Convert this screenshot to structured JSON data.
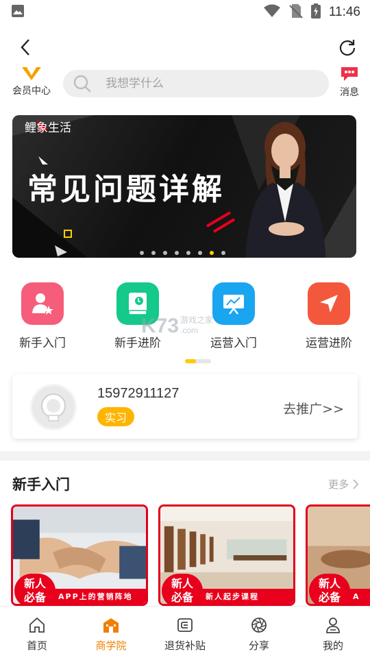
{
  "status_bar": {
    "time": "11:46"
  },
  "top_bar": {
    "member_center": "会员中心",
    "messages": "消息",
    "search_placeholder": "我想学什么"
  },
  "banner": {
    "brand": "鲤象生活",
    "headline": "常见问题详解",
    "dot_count": 8,
    "active_dot": 7
  },
  "categories": [
    {
      "label": "新手入门",
      "icon": "person-star-icon",
      "color": "#f55d7a"
    },
    {
      "label": "新手进阶",
      "icon": "book-icon",
      "color": "#14c98a"
    },
    {
      "label": "运营入门",
      "icon": "presentation-icon",
      "color": "#1aa5f0"
    },
    {
      "label": "运营进阶",
      "icon": "navigation-arrow-icon",
      "color": "#f4583c"
    }
  ],
  "watermark": {
    "site": "K73",
    "text": "游戏之家",
    "domain": ".com"
  },
  "user": {
    "phone": "15972911127",
    "level": "实习",
    "promote": "去推广>>"
  },
  "section": {
    "title": "新手入门",
    "more": "更多"
  },
  "courses": [
    {
      "tag": "新人必备",
      "ribbon": "APP上的营销阵地"
    },
    {
      "tag": "新人必备",
      "ribbon": "新人起步课程"
    },
    {
      "tag": "新人必备",
      "ribbon": "A"
    }
  ],
  "bottom_nav": [
    {
      "label": "首页",
      "icon": "home-icon"
    },
    {
      "label": "商学院",
      "icon": "school-icon",
      "active": true
    },
    {
      "label": "退货补贴",
      "icon": "subsidy-icon"
    },
    {
      "label": "分享",
      "icon": "share-aperture-icon"
    },
    {
      "label": "我的",
      "icon": "profile-icon"
    }
  ],
  "colors": {
    "accent": "#f08000",
    "badge": "#ffb400",
    "red": "#e8001c"
  }
}
